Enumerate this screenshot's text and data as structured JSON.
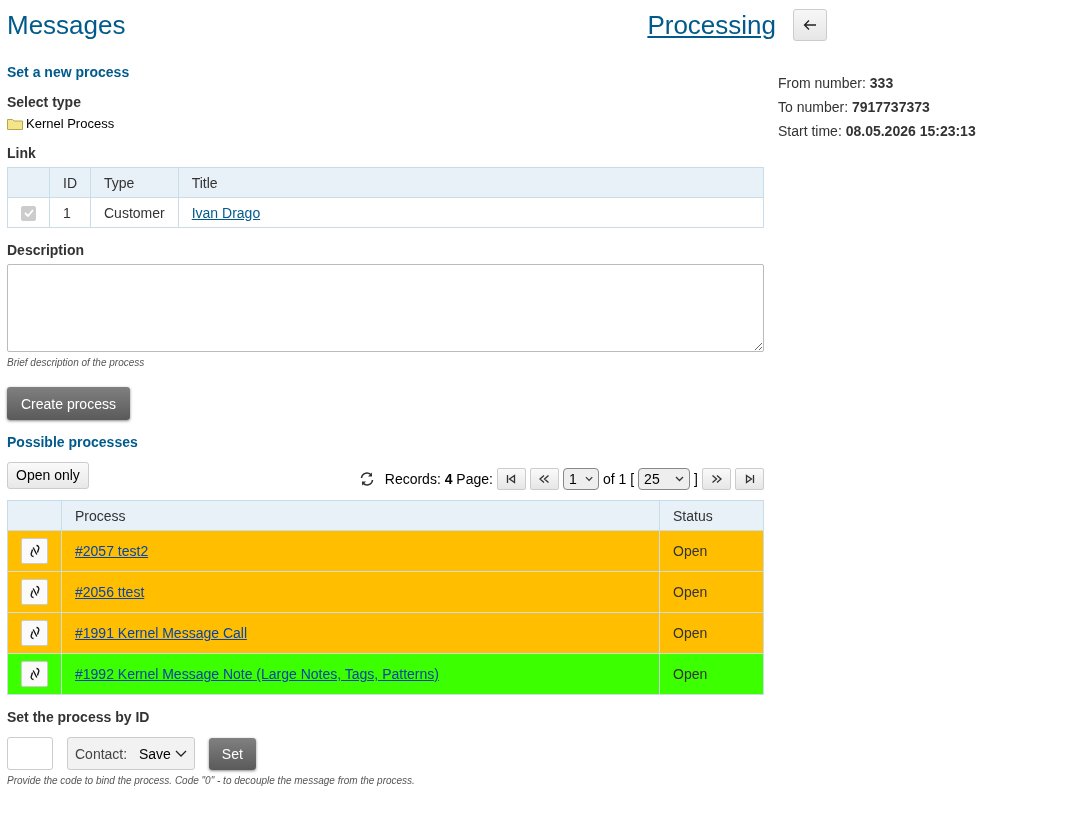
{
  "header": {
    "title": "Messages",
    "link": "Processing"
  },
  "new_process": {
    "heading": "Set a new process",
    "select_type_label": "Select type",
    "type": "Kernel Process",
    "link_label": "Link",
    "link_table": {
      "columns": [
        "ID",
        "Type",
        "Title"
      ],
      "rows": [
        {
          "checked": true,
          "id": "1",
          "type": "Customer",
          "title": "Ivan Drago"
        }
      ]
    },
    "description_label": "Description",
    "description_hint": "Brief description of the process",
    "create_button": "Create process"
  },
  "possible": {
    "heading": "Possible processes",
    "filter_button": "Open only",
    "records": "Records: **4** Page:",
    "page": "1",
    "of": "of 1 [",
    "page_size": "25",
    "close_bracket": "]",
    "columns": [
      "Process",
      "Status"
    ],
    "rows": [
      {
        "process": "#2057 test2",
        "status": "Open",
        "color": "#ffbf00"
      },
      {
        "process": "#2056 ttest",
        "status": "Open",
        "color": "#ffbf00"
      },
      {
        "process": "#1991 Kernel Message Call",
        "status": "Open",
        "color": "#ffbf00"
      },
      {
        "process": "#1992 Kernel Message Note (Large Notes, Tags, Patterns)",
        "status": "Open",
        "color": "#3cff00"
      }
    ]
  },
  "set_by_id": {
    "heading": "Set the process by ID",
    "contact_label": "Contact:",
    "contact_value": "Save",
    "set_button": "Set",
    "hint": "Provide the code to bind the process. Code \"0\" - to decouple the message from the process."
  },
  "info": [
    "From number: **333**",
    "To number: **7917737373**",
    "Start time: **08.05.2026 15:23:13**"
  ]
}
